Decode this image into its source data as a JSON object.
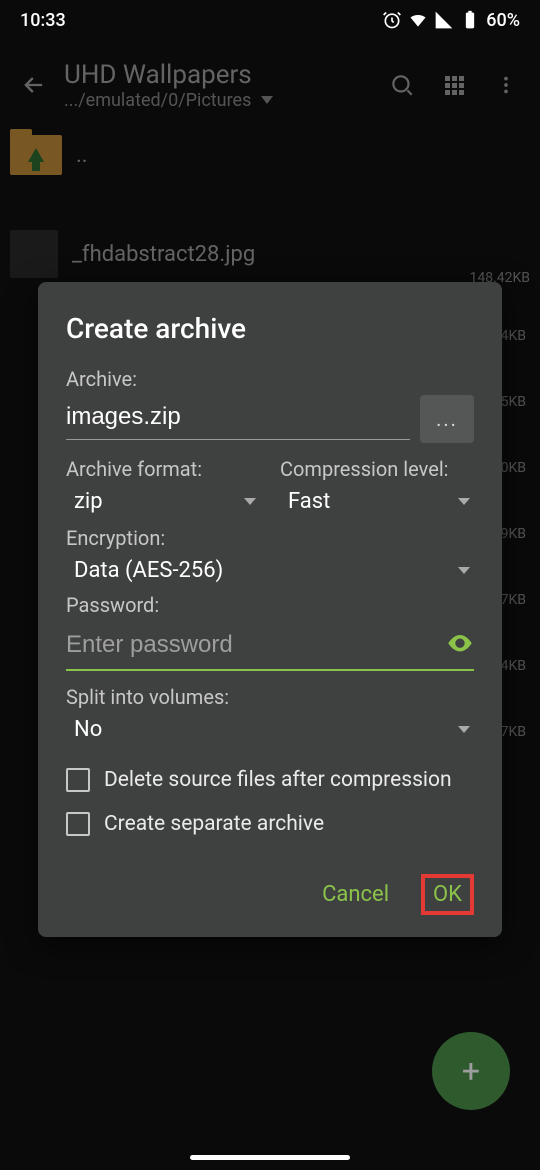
{
  "status": {
    "time": "10:33",
    "battery": "60%"
  },
  "header": {
    "title": "UHD Wallpapers",
    "path": ".../emulated/0/Pictures"
  },
  "files": {
    "up_label": "..",
    "rows": [
      {
        "name": "_fhdabstract28.jpg",
        "size": "148.42KB"
      }
    ],
    "visible_sizes": [
      "4KB",
      "5KB",
      "0KB",
      "9KB",
      "7KB",
      "4KB",
      "7KB"
    ]
  },
  "dialog": {
    "title": "Create archive",
    "archive_label": "Archive:",
    "archive_name": "images.zip",
    "browse_label": "...",
    "format_label": "Archive format:",
    "format_value": "zip",
    "compression_label": "Compression level:",
    "compression_value": "Fast",
    "encryption_label": "Encryption:",
    "encryption_value": "Data (AES-256)",
    "password_label": "Password:",
    "password_placeholder": "Enter password",
    "split_label": "Split into volumes:",
    "split_value": "No",
    "delete_label": "Delete source files after compression",
    "separate_label": "Create separate archive",
    "cancel": "Cancel",
    "ok": "OK"
  }
}
